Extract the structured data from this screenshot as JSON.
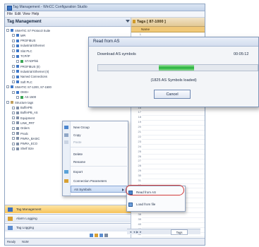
{
  "window": {
    "title": "Tag Management - WinCC Configuration Studio",
    "menu": [
      "File",
      "Edit",
      "View",
      "Help"
    ]
  },
  "left_pane": {
    "title": "Tag Management",
    "tree": [
      {
        "label": "SIMATIC S7 Protocol Suite",
        "icon": "protocol-icon"
      },
      {
        "label": "MPI",
        "icon": "network-icon"
      },
      {
        "label": "PROFIBUS",
        "icon": "network-icon"
      },
      {
        "label": "Industrial Ethernet",
        "icon": "network-icon"
      },
      {
        "label": "Slot PLC",
        "icon": "network-icon"
      },
      {
        "label": "TCP/IP",
        "icon": "network-icon"
      },
      {
        "label": "S7ADPlnk",
        "icon": "connection-icon"
      },
      {
        "label": "PROFIBUS (II)",
        "icon": "network-icon"
      },
      {
        "label": "Industrial Ethernet (II)",
        "icon": "network-icon"
      },
      {
        "label": "Named Connections",
        "icon": "network-icon"
      },
      {
        "label": "Soft PLC",
        "icon": "network-icon"
      },
      {
        "label": "SIMATIC S7-1200, S7-1500",
        "icon": "protocol-icon"
      },
      {
        "label": "OMS+",
        "icon": "network-icon"
      },
      {
        "label": "AS 1500",
        "icon": "connection-icon"
      },
      {
        "label": "Structure tags",
        "icon": "folder-icon"
      },
      {
        "label": "BufferPB",
        "icon": "struct-icon"
      },
      {
        "label": "BufferPB_AS",
        "icon": "struct-icon"
      },
      {
        "label": "Equipment",
        "icon": "struct-icon"
      },
      {
        "label": "LINK_PRT",
        "icon": "struct-icon"
      },
      {
        "label": "Orders",
        "icon": "struct-icon"
      },
      {
        "label": "Prodc",
        "icon": "struct-icon"
      },
      {
        "label": "PWRA_BASIC",
        "icon": "struct-icon"
      },
      {
        "label": "PWRA_ECO",
        "icon": "struct-icon"
      },
      {
        "label": "Shelf Size",
        "icon": "struct-icon"
      }
    ]
  },
  "right_pane": {
    "title": "Tags [ 87-1000 ]",
    "column": "Name",
    "row_numbers": [
      "1",
      "2",
      "3",
      "4",
      "5",
      "6",
      "7",
      "8",
      "9",
      "10",
      "11",
      "12",
      "13",
      "14",
      "15",
      "16",
      "17",
      "18",
      "19",
      "20",
      "21",
      "22",
      "23",
      "24",
      "25",
      "26",
      "27",
      "28",
      "29",
      "30",
      "31",
      "32",
      "33",
      "34",
      "35",
      "36",
      "37",
      "38",
      "39",
      "40",
      "41",
      "42",
      "43",
      "44"
    ],
    "tab": "Tags",
    "pager": "◄ ◄ ▶ ►"
  },
  "dialog": {
    "title": "Read from AS",
    "label": "Download AS symbols",
    "time": "00:05:12",
    "progress": 0.37,
    "message": "(1825 AS Symbols loaded)",
    "cancel": "Cancel"
  },
  "context_menu": {
    "items": [
      {
        "label": "New Group",
        "dim": false
      },
      {
        "label": "Copy",
        "dim": false
      },
      {
        "label": "Paste",
        "dim": true
      },
      {
        "label": "Delete",
        "dim": false
      },
      {
        "label": "Rename",
        "dim": false
      },
      {
        "label": "Export",
        "dim": false
      },
      {
        "label": "Connection Parameters",
        "dim": false
      },
      {
        "label": "AS Symbols",
        "dim": false
      }
    ]
  },
  "submenu": {
    "items": [
      "Read from AS",
      "Load from file"
    ]
  },
  "nav": {
    "buttons": [
      "Tag Management",
      "Alarm Logging",
      "Tag Logging"
    ]
  },
  "status": {
    "left": "Ready",
    "mid": "NUM"
  }
}
